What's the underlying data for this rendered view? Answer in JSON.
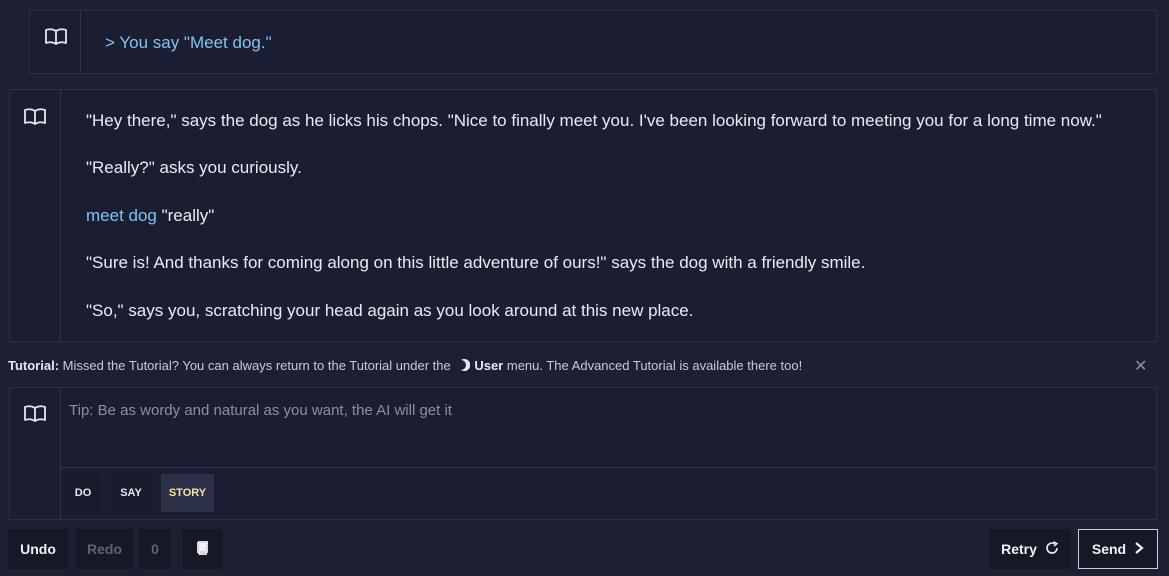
{
  "action": {
    "icon": "book-icon",
    "text": "> You say \"Meet dog.\""
  },
  "story": {
    "icon": "book-icon",
    "paragraphs": [
      "\"Hey there,\" says the dog as he licks his chops. \"Nice to finally meet you. I've been looking forward to meeting you for a long time now.\"",
      "\"Really?\" asks you curiously.",
      "\"Sure is! And thanks for coming along on this little adventure of ours!\" says the dog with a friendly smile.",
      "\"So,\" says you, scratching your head again as you look around at this new place."
    ],
    "inline_action_link": "meet dog",
    "inline_action_text": " \"really\""
  },
  "tutorial": {
    "label": "Tutorial:",
    "text_before": " Missed the Tutorial? You can always return to the Tutorial under the ",
    "menu_name": "User",
    "text_after": " menu. The Advanced Tutorial is available there too!",
    "close_icon": "close-icon",
    "close_glyph": "✕"
  },
  "input": {
    "placeholder": "Tip: Be as wordy and natural as you want, the AI will get it",
    "modes": [
      "DO",
      "SAY",
      "STORY"
    ],
    "active_mode": "STORY"
  },
  "bottom": {
    "undo": "Undo",
    "redo": "Redo",
    "count": "0",
    "retry": "Retry",
    "send": "Send"
  },
  "colors": {
    "background": "#1d2033",
    "panel": "#1b1e30",
    "link": "#7ec3f5",
    "active_mode_text": "#f3e3a8"
  }
}
